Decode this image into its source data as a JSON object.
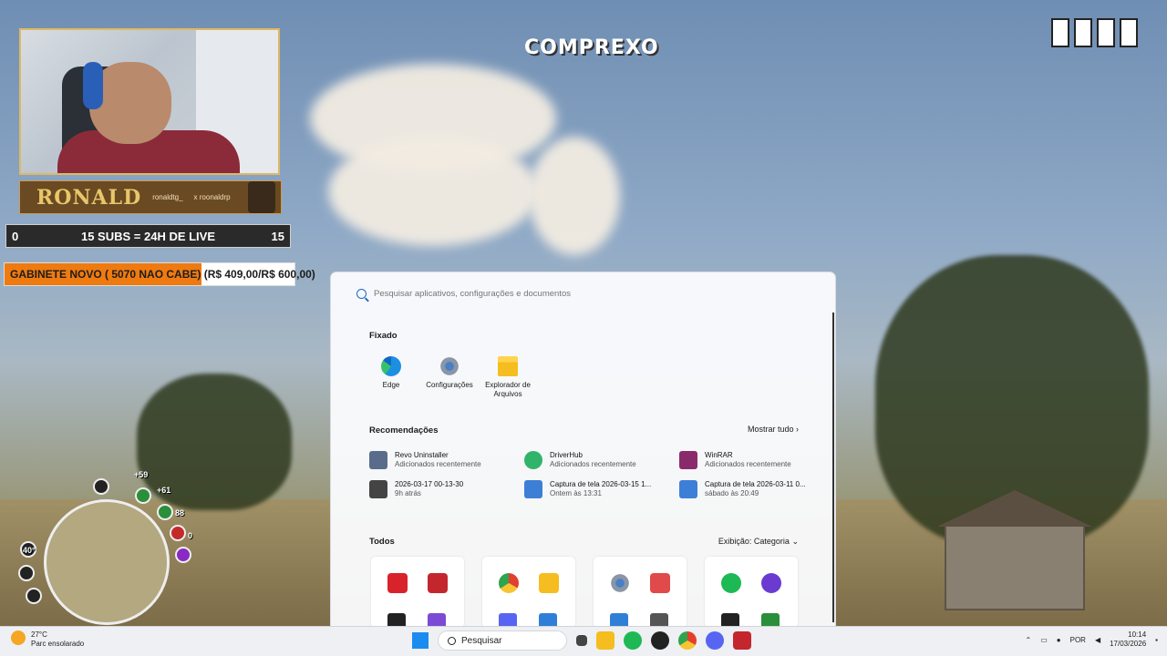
{
  "overlay": {
    "brand": "COMPREXO",
    "streamer_name": "RONALD",
    "social_1": "ronaldtg_",
    "social_2": "x roonaldrp",
    "goal": {
      "left": "0",
      "text": "15 SUBS = 24H DE LIVE",
      "right": "15"
    },
    "donation": {
      "text": "GABINETE NOVO ( 5070 NAO CABE) (R$ 409,00/R$ 600,00)",
      "progress_fraction": 0.68
    }
  },
  "hud": {
    "values": [
      "+59",
      "+61",
      "88",
      "0",
      "40°"
    ]
  },
  "start_menu": {
    "search_placeholder": "Pesquisar aplicativos, configurações e documentos",
    "pinned_title": "Fixado",
    "pinned": [
      {
        "label": "Edge",
        "icon": "edge-icon"
      },
      {
        "label": "Configurações",
        "icon": "gear-icon"
      },
      {
        "label": "Explorador de Arquivos",
        "icon": "folder-icon"
      }
    ],
    "recommendations_title": "Recomendações",
    "show_all_label": "Mostrar tudo",
    "recommendations": [
      {
        "title": "Revo Uninstaller",
        "sub": "Adicionados recentemente",
        "icon": "revo-icon",
        "color": "#5a6c8c"
      },
      {
        "title": "DriverHub",
        "sub": "Adicionados recentemente",
        "icon": "driverhub-icon",
        "color": "#2fb46a"
      },
      {
        "title": "WinRAR",
        "sub": "Adicionados recentemente",
        "icon": "winrar-icon",
        "color": "#8b2a6b"
      },
      {
        "title": "2026-03-17 00-13-30",
        "sub": "9h atrás",
        "icon": "video-file-icon",
        "color": "#444444"
      },
      {
        "title": "Captura de tela 2026-03-15 1...",
        "sub": "Ontem às 13:31",
        "icon": "image-file-icon",
        "color": "#3d7fd6"
      },
      {
        "title": "Captura de tela 2026-03-11 0...",
        "sub": "sábado às 20:49",
        "icon": "image-file-icon",
        "color": "#3d7fd6"
      }
    ],
    "all_title": "Todos",
    "view_label": "Exibição: Categoria"
  },
  "taskbar": {
    "weather_temp": "27°C",
    "weather_desc": "Parc ensolarado",
    "search_label": "Pesquisar",
    "language": "POR",
    "time": "10:14",
    "date": "17/03/2026"
  },
  "colors": {
    "accent": "#1a8cf0",
    "donation_fill": "#ef7a10"
  }
}
